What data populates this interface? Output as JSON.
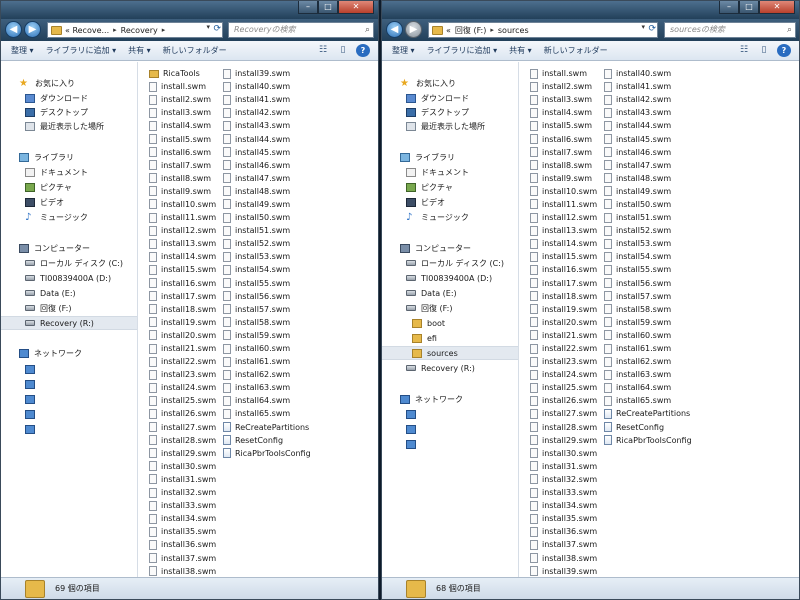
{
  "left": {
    "address": [
      "« Recove...",
      "Recovery"
    ],
    "search_placeholder": "Recoveryの検索",
    "toolbar": [
      "整理 ▾",
      "ライブラリに追加 ▾",
      "共有 ▾",
      "新しいフォルダー"
    ],
    "nav": [
      {
        "label": "お気に入り",
        "icon": "star-icon",
        "cls": "ic-star",
        "glyph": "★"
      },
      {
        "label": "ダウンロード",
        "icon": "downloads-icon",
        "cls": "ic-dl"
      },
      {
        "label": "デスクトップ",
        "icon": "desktop-icon",
        "cls": "ic-desk"
      },
      {
        "label": "最近表示した場所",
        "icon": "recent-places-icon",
        "cls": "ic-recent"
      },
      {
        "label": "ライブラリ",
        "icon": "library-icon",
        "cls": "ic-lib"
      },
      {
        "label": "ドキュメント",
        "icon": "documents-icon",
        "cls": "ic-doc"
      },
      {
        "label": "ピクチャ",
        "icon": "pictures-icon",
        "cls": "ic-pic"
      },
      {
        "label": "ビデオ",
        "icon": "videos-icon",
        "cls": "ic-vid"
      },
      {
        "label": "ミュージック",
        "icon": "music-icon",
        "cls": "ic-music",
        "glyph": "♪"
      },
      {
        "label": "コンピューター",
        "icon": "computer-icon",
        "cls": "ic-comp"
      },
      {
        "label": "ローカル ディスク (C:)",
        "icon": "drive-icon",
        "cls": "ic-drive"
      },
      {
        "label": "TI00839400A (D:)",
        "icon": "drive-icon",
        "cls": "ic-drive"
      },
      {
        "label": "Data (E:)",
        "icon": "drive-icon",
        "cls": "ic-drive"
      },
      {
        "label": "回復 (F:)",
        "icon": "drive-icon",
        "cls": "ic-drive"
      },
      {
        "label": "Recovery (R:)",
        "icon": "drive-icon",
        "cls": "ic-drive"
      },
      {
        "label": "ネットワーク",
        "icon": "network-icon",
        "cls": "ic-net"
      },
      {
        "label": "",
        "icon": "network-computer-icon",
        "cls": "ic-net"
      },
      {
        "label": "",
        "icon": "network-computer-icon",
        "cls": "ic-net"
      },
      {
        "label": "",
        "icon": "network-computer-icon",
        "cls": "ic-net"
      },
      {
        "label": "",
        "icon": "network-computer-icon",
        "cls": "ic-net"
      },
      {
        "label": "",
        "icon": "network-computer-icon",
        "cls": "ic-net"
      }
    ],
    "files": [
      "RicaTools",
      "install.swm",
      "install2.swm",
      "install3.swm",
      "install4.swm",
      "install5.swm",
      "install6.swm",
      "install7.swm",
      "install8.swm",
      "install9.swm",
      "install10.swm",
      "install11.swm",
      "install12.swm",
      "install13.swm",
      "install14.swm",
      "install15.swm",
      "install16.swm",
      "install17.swm",
      "install18.swm",
      "install19.swm",
      "install20.swm",
      "install21.swm",
      "install22.swm",
      "install23.swm",
      "install24.swm",
      "install25.swm",
      "install26.swm",
      "install27.swm",
      "install28.swm",
      "install29.swm",
      "install30.swm",
      "install31.swm",
      "install32.swm",
      "install33.swm",
      "install34.swm",
      "install35.swm",
      "install36.swm",
      "install37.swm",
      "install38.swm",
      "install39.swm",
      "install40.swm",
      "install41.swm",
      "install42.swm",
      "install43.swm",
      "install44.swm",
      "install45.swm",
      "install46.swm",
      "install47.swm",
      "install48.swm",
      "install49.swm",
      "install50.swm",
      "install51.swm",
      "install52.swm",
      "install53.swm",
      "install54.swm",
      "install55.swm",
      "install56.swm",
      "install57.swm",
      "install58.swm",
      "install59.swm",
      "install60.swm",
      "install61.swm",
      "install62.swm",
      "install63.swm",
      "install64.swm",
      "install65.swm",
      "ReCreatePartitions",
      "ResetConfig",
      "RicaPbrToolsConfig"
    ],
    "status": "69 個の項目"
  },
  "right": {
    "address": [
      "«",
      "回復 (F:)",
      "sources"
    ],
    "search_placeholder": "sourcesの検索",
    "toolbar": [
      "整理 ▾",
      "ライブラリに追加 ▾",
      "共有 ▾",
      "新しいフォルダー"
    ],
    "nav": [
      {
        "label": "お気に入り",
        "icon": "star-icon",
        "cls": "ic-star",
        "glyph": "★"
      },
      {
        "label": "ダウンロード",
        "icon": "downloads-icon",
        "cls": "ic-dl"
      },
      {
        "label": "デスクトップ",
        "icon": "desktop-icon",
        "cls": "ic-desk"
      },
      {
        "label": "最近表示した場所",
        "icon": "recent-places-icon",
        "cls": "ic-recent"
      },
      {
        "label": "ライブラリ",
        "icon": "library-icon",
        "cls": "ic-lib"
      },
      {
        "label": "ドキュメント",
        "icon": "documents-icon",
        "cls": "ic-doc"
      },
      {
        "label": "ピクチャ",
        "icon": "pictures-icon",
        "cls": "ic-pic"
      },
      {
        "label": "ビデオ",
        "icon": "videos-icon",
        "cls": "ic-vid"
      },
      {
        "label": "ミュージック",
        "icon": "music-icon",
        "cls": "ic-music",
        "glyph": "♪"
      },
      {
        "label": "コンピューター",
        "icon": "computer-icon",
        "cls": "ic-comp"
      },
      {
        "label": "ローカル ディスク (C:)",
        "icon": "drive-icon",
        "cls": "ic-drive"
      },
      {
        "label": "TI00839400A (D:)",
        "icon": "drive-icon",
        "cls": "ic-drive"
      },
      {
        "label": "Data (E:)",
        "icon": "drive-icon",
        "cls": "ic-drive"
      },
      {
        "label": "回復 (F:)",
        "icon": "drive-icon",
        "cls": "ic-drive"
      },
      {
        "label": "boot",
        "icon": "folder-icon",
        "cls": "ic-folder"
      },
      {
        "label": "efi",
        "icon": "folder-icon",
        "cls": "ic-folder"
      },
      {
        "label": "sources",
        "icon": "folder-icon",
        "cls": "ic-folder"
      },
      {
        "label": "Recovery (R:)",
        "icon": "drive-icon",
        "cls": "ic-drive"
      },
      {
        "label": "ネットワーク",
        "icon": "network-icon",
        "cls": "ic-net"
      },
      {
        "label": "",
        "icon": "network-computer-icon",
        "cls": "ic-net"
      },
      {
        "label": "",
        "icon": "network-computer-icon",
        "cls": "ic-net"
      },
      {
        "label": "",
        "icon": "network-computer-icon",
        "cls": "ic-net"
      }
    ],
    "files": [
      "install.swm",
      "install2.swm",
      "install3.swm",
      "install4.swm",
      "install5.swm",
      "install6.swm",
      "install7.swm",
      "install8.swm",
      "install9.swm",
      "install10.swm",
      "install11.swm",
      "install12.swm",
      "install13.swm",
      "install14.swm",
      "install15.swm",
      "install16.swm",
      "install17.swm",
      "install18.swm",
      "install19.swm",
      "install20.swm",
      "install21.swm",
      "install22.swm",
      "install23.swm",
      "install24.swm",
      "install25.swm",
      "install26.swm",
      "install27.swm",
      "install28.swm",
      "install29.swm",
      "install30.swm",
      "install31.swm",
      "install32.swm",
      "install33.swm",
      "install34.swm",
      "install35.swm",
      "install36.swm",
      "install37.swm",
      "install38.swm",
      "install39.swm",
      "install40.swm",
      "install41.swm",
      "install42.swm",
      "install43.swm",
      "install44.swm",
      "install45.swm",
      "install46.swm",
      "install47.swm",
      "install48.swm",
      "install49.swm",
      "install50.swm",
      "install51.swm",
      "install52.swm",
      "install53.swm",
      "install54.swm",
      "install55.swm",
      "install56.swm",
      "install57.swm",
      "install58.swm",
      "install59.swm",
      "install60.swm",
      "install61.swm",
      "install62.swm",
      "install63.swm",
      "install64.swm",
      "install65.swm",
      "ReCreatePartitions",
      "ResetConfig",
      "RicaPbrToolsConfig"
    ],
    "status": "68 個の項目"
  }
}
